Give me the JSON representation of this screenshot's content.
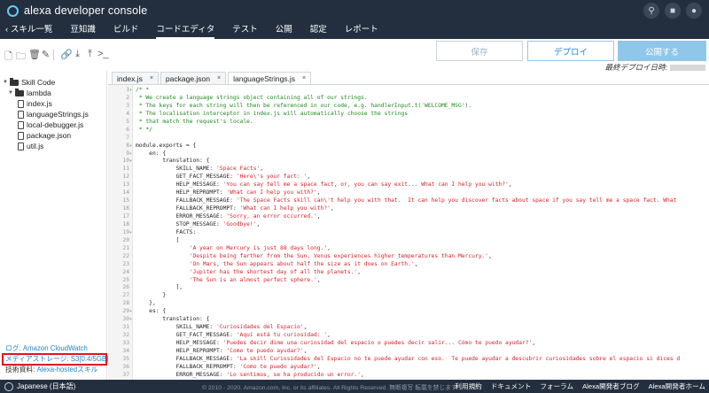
{
  "app": {
    "title": "alexa developer console"
  },
  "nav": {
    "back_label": "スキル一覧",
    "items": [
      "豆知識",
      "ビルド",
      "コードエディタ",
      "テスト",
      "公開",
      "認定",
      "レポート"
    ],
    "active_index": 2
  },
  "toolbar": {
    "save_label": "保存",
    "deploy_label": "デプロイ",
    "publish_label": "公開する",
    "last_deploy_label": "最終デプロイ日時:"
  },
  "sidebar": {
    "root": "Skill Code",
    "folder": "lambda",
    "files": [
      "index.js",
      "languageStrings.js",
      "local-debugger.js",
      "package.json",
      "util.js"
    ],
    "footer": {
      "log_link": "ログ: Amazon CloudWatch",
      "media_prefix": "メディアストレージ: ",
      "media_link": "S3[0.4/5GB]",
      "docs_prefix": "技術資料: ",
      "docs_link": "Alexa-hostedスキル"
    }
  },
  "tabs": [
    {
      "label": "index.js",
      "close": "×"
    },
    {
      "label": "package.json",
      "close": "×"
    },
    {
      "label": "languageStrings.js",
      "close": "×"
    }
  ],
  "active_tab": 2,
  "code_lines": [
    {
      "n": "1",
      "fold": "▾",
      "type": "comment",
      "text": "/* *"
    },
    {
      "n": "2",
      "fold": "",
      "type": "comment",
      "text": " * We create a language strings object containing all of our strings."
    },
    {
      "n": "3",
      "fold": "",
      "type": "comment",
      "text": " * The keys for each string will then be referenced in our code, e.g. handlerInput.t('WELCOME_MSG')."
    },
    {
      "n": "4",
      "fold": "",
      "type": "comment",
      "text": " * The localisation interceptor in index.js will automatically choose the strings"
    },
    {
      "n": "5",
      "fold": "",
      "type": "comment",
      "text": " * that match the request's locale."
    },
    {
      "n": "6",
      "fold": "",
      "type": "comment",
      "text": " * */"
    },
    {
      "n": "7",
      "fold": "",
      "type": "code",
      "text": ""
    },
    {
      "n": "8",
      "fold": "▾",
      "type": "code",
      "text": "module.exports = {"
    },
    {
      "n": "9",
      "fold": "▾",
      "type": "code",
      "text": "    en: {"
    },
    {
      "n": "10",
      "fold": "▾",
      "type": "code",
      "text": "        translation: {"
    },
    {
      "n": "11",
      "fold": "",
      "type": "kv",
      "key": "            SKILL_NAME: ",
      "val": "'Space Facts'",
      "tail": ","
    },
    {
      "n": "12",
      "fold": "",
      "type": "kv",
      "key": "            GET_FACT_MESSAGE: ",
      "val": "'Here\\'s your fact: '",
      "tail": ","
    },
    {
      "n": "13",
      "fold": "",
      "type": "kv",
      "key": "            HELP_MESSAGE: ",
      "val": "'You can say tell me a space fact, or, you can say exit... What can I help you with?'",
      "tail": ","
    },
    {
      "n": "14",
      "fold": "",
      "type": "kv",
      "key": "            HELP_REPROMPT: ",
      "val": "'What can I help you with?'",
      "tail": ","
    },
    {
      "n": "15",
      "fold": "",
      "type": "kv",
      "key": "            FALLBACK_MESSAGE: ",
      "val": "'The Space Facts skill can\\'t help you with that.  It can help you discover facts about space if you say tell me a space fact. What",
      "tail": ""
    },
    {
      "n": "16",
      "fold": "",
      "type": "kv",
      "key": "            FALLBACK_REPROMPT: ",
      "val": "'What can I help you with?'",
      "tail": ","
    },
    {
      "n": "17",
      "fold": "",
      "type": "kv",
      "key": "            ERROR_MESSAGE: ",
      "val": "'Sorry, an error occurred.'",
      "tail": ","
    },
    {
      "n": "18",
      "fold": "",
      "type": "kv",
      "key": "            STOP_MESSAGE: ",
      "val": "'Goodbye!'",
      "tail": ","
    },
    {
      "n": "19",
      "fold": "▾",
      "type": "code",
      "text": "            FACTS:"
    },
    {
      "n": "20",
      "fold": "",
      "type": "code",
      "text": "            ["
    },
    {
      "n": "21",
      "fold": "",
      "type": "kv",
      "key": "                ",
      "val": "'A year on Mercury is just 88 days long.'",
      "tail": ","
    },
    {
      "n": "22",
      "fold": "",
      "type": "kv",
      "key": "                ",
      "val": "'Despite being farther from the Sun, Venus experiences higher temperatures than Mercury.'",
      "tail": ","
    },
    {
      "n": "23",
      "fold": "",
      "type": "kv",
      "key": "                ",
      "val": "'On Mars, the Sun appears about half the size as it does on Earth.'",
      "tail": ","
    },
    {
      "n": "24",
      "fold": "",
      "type": "kv",
      "key": "                ",
      "val": "'Jupiter has the shortest day of all the planets.'",
      "tail": ","
    },
    {
      "n": "25",
      "fold": "",
      "type": "kv",
      "key": "                ",
      "val": "'The Sun is an almost perfect sphere.'",
      "tail": ","
    },
    {
      "n": "26",
      "fold": "",
      "type": "code",
      "text": "            ],"
    },
    {
      "n": "27",
      "fold": "",
      "type": "code",
      "text": "        }"
    },
    {
      "n": "28",
      "fold": "",
      "type": "code",
      "text": "    },"
    },
    {
      "n": "29",
      "fold": "▾",
      "type": "code",
      "text": "    es: {"
    },
    {
      "n": "30",
      "fold": "▾",
      "type": "code",
      "text": "        translation: {"
    },
    {
      "n": "31",
      "fold": "",
      "type": "kv",
      "key": "            SKILL_NAME: ",
      "val": "'Curiosidades del Espacio'",
      "tail": ","
    },
    {
      "n": "32",
      "fold": "",
      "type": "kv",
      "key": "            GET_FACT_MESSAGE: ",
      "val": "'Aquí está tu curiosidad: '",
      "tail": ","
    },
    {
      "n": "33",
      "fold": "",
      "type": "kv",
      "key": "            HELP_MESSAGE: ",
      "val": "'Puedes decir dime una curiosidad del espacio o puedes decir salir... Cómo te puedo ayudar?'",
      "tail": ","
    },
    {
      "n": "34",
      "fold": "",
      "type": "kv",
      "key": "            HELP_REPROMPT: ",
      "val": "'Como te puedo ayudar?'",
      "tail": ","
    },
    {
      "n": "35",
      "fold": "",
      "type": "kv",
      "key": "            FALLBACK_MESSAGE: ",
      "val": "'La skill Curiosidades del Espacio no te puede ayudar con eso.  Te puede ayudar a descubrir curiosidades sobre el espacio si dices d",
      "tail": ""
    },
    {
      "n": "36",
      "fold": "",
      "type": "kv",
      "key": "            FALLBACK_REPROMPT: ",
      "val": "'Como te puedo ayudar?'",
      "tail": ","
    },
    {
      "n": "37",
      "fold": "",
      "type": "kv",
      "key": "            ERROR_MESSAGE: ",
      "val": "'Lo sentimos, se ha producido un error.'",
      "tail": ","
    }
  ],
  "footer": {
    "language": "Japanese (日本語)",
    "copyright": "© 2010 - 2020, Amazon.com, Inc. or its affiliates. All Rights Reserved. 無断複写 転載を禁じます",
    "links": [
      "利用規約",
      "ドキュメント",
      "フォーラム",
      "Alexa開発者ブログ",
      "Alexa開発者ホーム"
    ]
  },
  "colors": {
    "chrome": "#232f3e",
    "accent": "#1f86c9",
    "comment": "#1e8a1e",
    "string": "#d8232a",
    "highlight_box": "#e3131b"
  }
}
